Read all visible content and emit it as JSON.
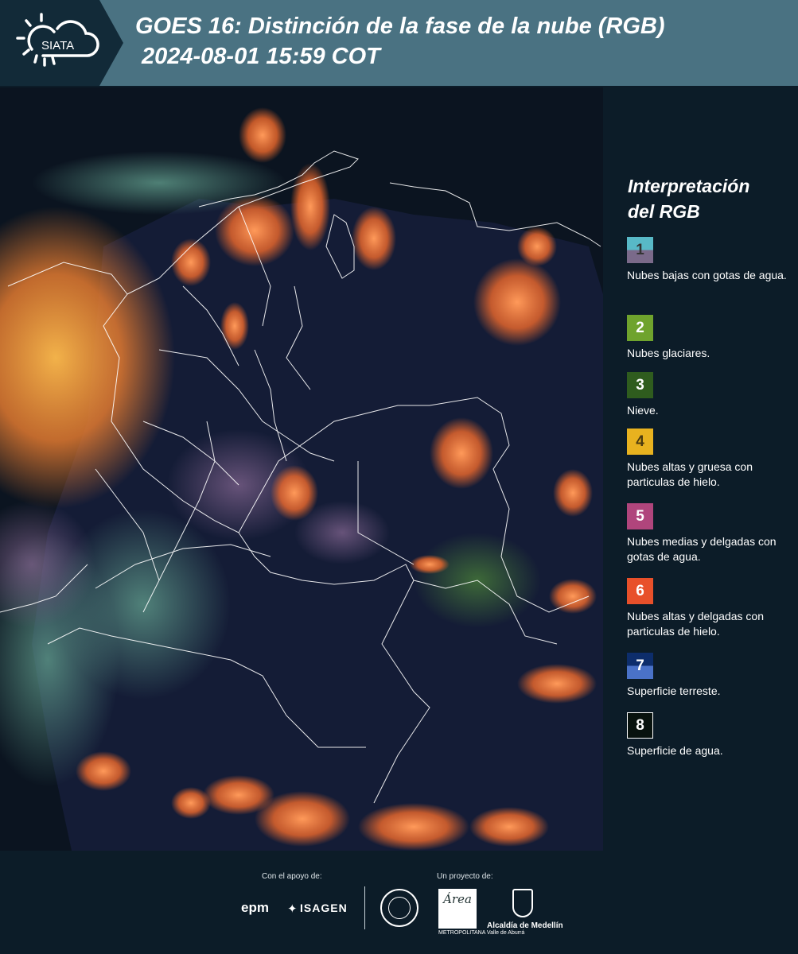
{
  "header": {
    "logo_text": "SIATA",
    "title": "GOES 16: Distinción de la fase de la nube (RGB)",
    "subtitle": "2024-08-01 15:59 COT",
    "background_color": "#4a7282"
  },
  "legend": {
    "title": "Interpretación\ndel RGB",
    "items": [
      {
        "number": "1",
        "label": "Nubes bajas con gotas de agua.",
        "color_top": "#58b9c7",
        "color_bottom": "#7a6a8a"
      },
      {
        "number": "2",
        "label": "Nubes glaciares.",
        "color_top": "#6fa32d",
        "color_bottom": "#6fa32d"
      },
      {
        "number": "3",
        "label": "Nieve.",
        "color_top": "#2f5c1e",
        "color_bottom": "#2f5c1e"
      },
      {
        "number": "4",
        "label": "Nubes altas y gruesa con particulas de hielo.",
        "color_top": "#e8b21f",
        "color_bottom": "#e8b21f"
      },
      {
        "number": "5",
        "label": "Nubes medias y delgadas con gotas de agua.",
        "color_top": "#b0457c",
        "color_bottom": "#b0457c"
      },
      {
        "number": "6",
        "label": "Nubes altas y delgadas con particulas de hielo.",
        "color_top": "#e8502a",
        "color_bottom": "#e8502a"
      },
      {
        "number": "7",
        "label": "Superficie terreste.",
        "color_top": "#0d2d6b",
        "color_bottom": "#4a72c8"
      },
      {
        "number": "8",
        "label": "Superficie de agua.",
        "color_top": "#08120e",
        "color_bottom": "#08120e"
      }
    ]
  },
  "footer": {
    "support_label": "Con el apoyo de:",
    "project_label": "Un proyecto de:",
    "epm_text": "epm",
    "isagen_text": "ISAGEN",
    "area_text": "Área",
    "area_subtext": "METROPOLITANA Valle de Aburrá",
    "alcaldia_text": "Alcaldía de Medellín"
  }
}
